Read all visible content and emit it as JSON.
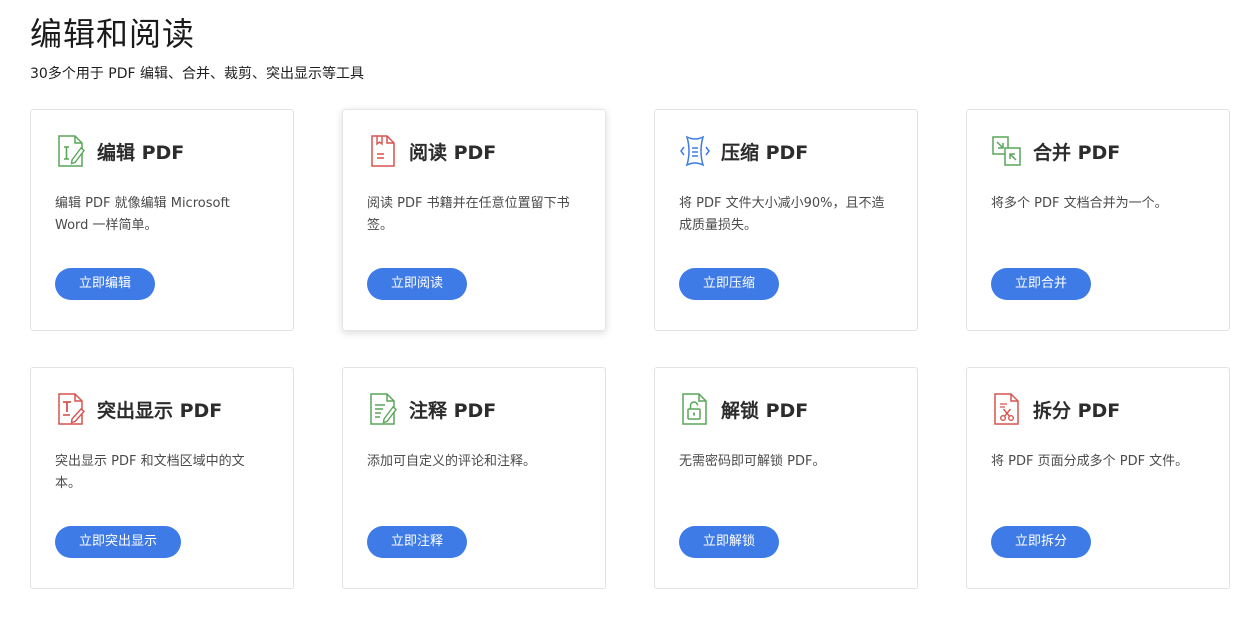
{
  "header": {
    "title": "编辑和阅读",
    "subtitle": "30多个用于 PDF 编辑、合并、裁剪、突出显示等工具"
  },
  "cards": [
    {
      "icon": "edit-pdf-icon",
      "title": "编辑 PDF",
      "desc": "编辑 PDF 就像编辑 Microsoft Word 一样简单。",
      "button": "立即编辑",
      "accent": "#5aa65a"
    },
    {
      "icon": "read-pdf-icon",
      "title": "阅读 PDF",
      "desc": "阅读 PDF 书籍并在任意位置留下书签。",
      "button": "立即阅读",
      "accent": "#d9534f"
    },
    {
      "icon": "compress-pdf-icon",
      "title": "压缩 PDF",
      "desc": "将 PDF 文件大小减小90%，且不造成质量损失。",
      "button": "立即压缩",
      "accent": "#3f7be6"
    },
    {
      "icon": "merge-pdf-icon",
      "title": "合并 PDF",
      "desc": "将多个 PDF 文档合并为一个。",
      "button": "立即合并",
      "accent": "#5aa65a"
    },
    {
      "icon": "highlight-pdf-icon",
      "title": "突出显示 PDF",
      "desc": "突出显示 PDF 和文档区域中的文本。",
      "button": "立即突出显示",
      "accent": "#d9534f"
    },
    {
      "icon": "annotate-pdf-icon",
      "title": "注释 PDF",
      "desc": "添加可自定义的评论和注释。",
      "button": "立即注释",
      "accent": "#5aa65a"
    },
    {
      "icon": "unlock-pdf-icon",
      "title": "解锁 PDF",
      "desc": "无需密码即可解锁 PDF。",
      "button": "立即解锁",
      "accent": "#5aa65a"
    },
    {
      "icon": "split-pdf-icon",
      "title": "拆分 PDF",
      "desc": "将 PDF 页面分成多个 PDF 文件。",
      "button": "立即拆分",
      "accent": "#d9534f"
    }
  ],
  "colors": {
    "button": "#3f7be6",
    "border": "#e2e2e2"
  }
}
